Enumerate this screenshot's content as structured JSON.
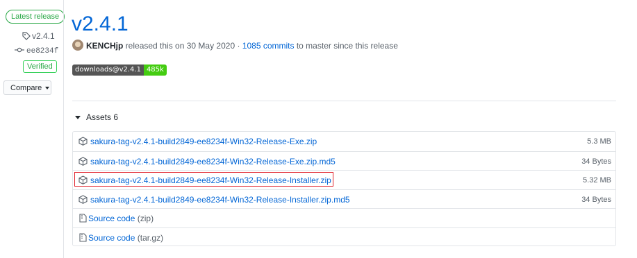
{
  "sidebar": {
    "latest_label": "Latest release",
    "tag": "v2.4.1",
    "commit": "ee8234f",
    "verified": "Verified",
    "compare": "Compare"
  },
  "release": {
    "title": "v2.4.1",
    "author": "KENCHjp",
    "released_text": "released this on 30 May 2020 ·",
    "commits_link": "1085 commits",
    "suffix": "to master since this release"
  },
  "badge": {
    "left": "downloads@v2.4.1",
    "right": "485k"
  },
  "assets": {
    "heading": "Assets",
    "count": "6",
    "files": [
      {
        "name": "sakura-tag-v2.4.1-build2849-ee8234f-Win32-Release-Exe.zip",
        "size": "5.3 MB"
      },
      {
        "name": "sakura-tag-v2.4.1-build2849-ee8234f-Win32-Release-Exe.zip.md5",
        "size": "34 Bytes"
      },
      {
        "name": "sakura-tag-v2.4.1-build2849-ee8234f-Win32-Release-Installer.zip",
        "size": "5.32 MB"
      },
      {
        "name": "sakura-tag-v2.4.1-build2849-ee8234f-Win32-Release-Installer.zip.md5",
        "size": "34 Bytes"
      }
    ],
    "source": [
      {
        "label": "Source code",
        "format": "(zip)"
      },
      {
        "label": "Source code",
        "format": "(tar.gz)"
      }
    ]
  },
  "colors": {
    "link": "#0366d6",
    "accent_green": "#28a745",
    "highlight": "#e0202a"
  }
}
